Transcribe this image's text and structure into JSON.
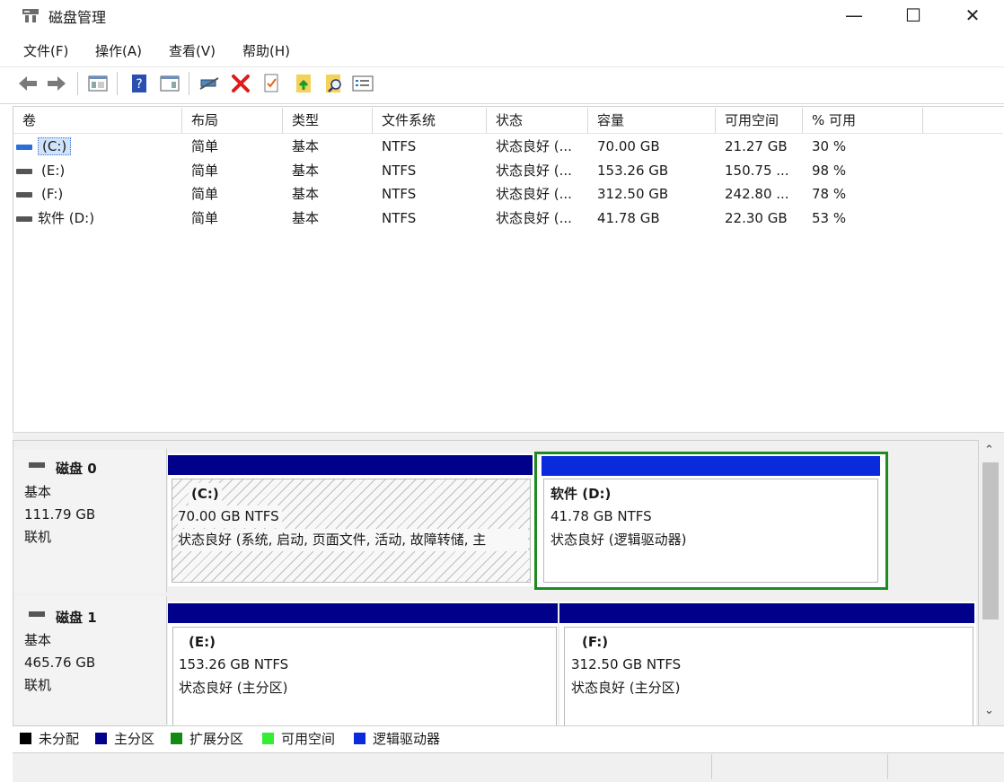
{
  "window": {
    "title": "磁盘管理",
    "minimize": "—",
    "maximize": "☐",
    "close": "✕"
  },
  "menu": [
    "文件(F)",
    "操作(A)",
    "查看(V)",
    "帮助(H)"
  ],
  "toolbar": {
    "icons": [
      "back-icon",
      "forward-icon",
      "console-tree-icon",
      "help-icon",
      "show-hide-icon",
      "connect-icon",
      "delete-icon",
      "properties-icon",
      "refresh-icon",
      "rescan-icon",
      "details-icon"
    ]
  },
  "volume_list": {
    "columns": [
      "卷",
      "布局",
      "类型",
      "文件系统",
      "状态",
      "容量",
      "可用空间",
      "% 可用"
    ],
    "rows": [
      {
        "volume": "(C:)",
        "layout": "简单",
        "type": "基本",
        "fs": "NTFS",
        "status": "状态良好 (...",
        "capacity": "70.00 GB",
        "free": "21.27 GB",
        "pct": "30 %"
      },
      {
        "volume": "(E:)",
        "layout": "简单",
        "type": "基本",
        "fs": "NTFS",
        "status": "状态良好 (...",
        "capacity": "153.26 GB",
        "free": "150.75 ...",
        "pct": "98 %"
      },
      {
        "volume": "(F:)",
        "layout": "简单",
        "type": "基本",
        "fs": "NTFS",
        "status": "状态良好 (...",
        "capacity": "312.50 GB",
        "free": "242.80 ...",
        "pct": "78 %"
      },
      {
        "volume": "软件 (D:)",
        "layout": "简单",
        "type": "基本",
        "fs": "NTFS",
        "status": "状态良好 (...",
        "capacity": "41.78 GB",
        "free": "22.30 GB",
        "pct": "53 %"
      }
    ]
  },
  "disks": [
    {
      "name": "磁盘 0",
      "type": "基本",
      "size": "111.79 GB",
      "state": "联机",
      "partitions": [
        {
          "title": "(C:)",
          "size_fs": "70.00 GB NTFS",
          "status": "状态良好 (系统, 启动, 页面文件, 活动, 故障转储, 主"
        },
        {
          "title": "软件  (D:)",
          "size_fs": "41.78 GB NTFS",
          "status": "状态良好 (逻辑驱动器)"
        }
      ]
    },
    {
      "name": "磁盘 1",
      "type": "基本",
      "size": "465.76 GB",
      "state": "联机",
      "partitions": [
        {
          "title": "(E:)",
          "size_fs": "153.26 GB NTFS",
          "status": "状态良好 (主分区)"
        },
        {
          "title": "(F:)",
          "size_fs": "312.50 GB NTFS",
          "status": "状态良好 (主分区)"
        }
      ]
    }
  ],
  "legend": [
    {
      "label": "未分配",
      "color": "#000000"
    },
    {
      "label": "主分区",
      "color": "#00008b"
    },
    {
      "label": "扩展分区",
      "color": "#138a13"
    },
    {
      "label": "可用空间",
      "color": "#33ee33"
    },
    {
      "label": "逻辑驱动器",
      "color": "#0a2bdc"
    }
  ],
  "colors": {
    "primary_partition": "#00008b",
    "logical_drive": "#0a2bdc",
    "selected_border": "#1f8a1f",
    "selection_highlight": "#2b6fd6"
  }
}
